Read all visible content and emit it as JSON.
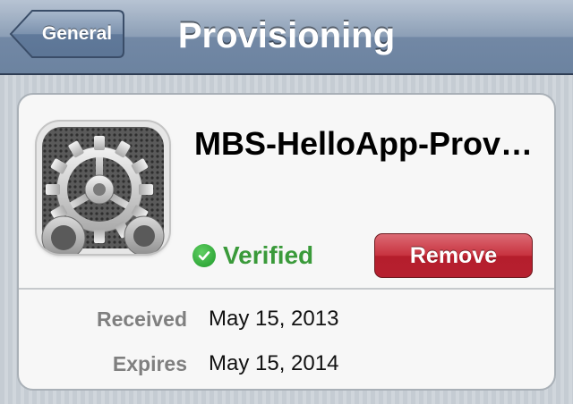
{
  "navbar": {
    "back_label": "General",
    "title": "Provisioning"
  },
  "profile": {
    "name": "MBS-HelloApp-Prov…",
    "status": "Verified",
    "remove_label": "Remove",
    "icon": "settings-gear-icon",
    "status_color": "#3a9a3a",
    "remove_color": "#c7323e"
  },
  "details": [
    {
      "label": "Received",
      "value": "May 15, 2013"
    },
    {
      "label": "Expires",
      "value": "May 15, 2014"
    }
  ]
}
